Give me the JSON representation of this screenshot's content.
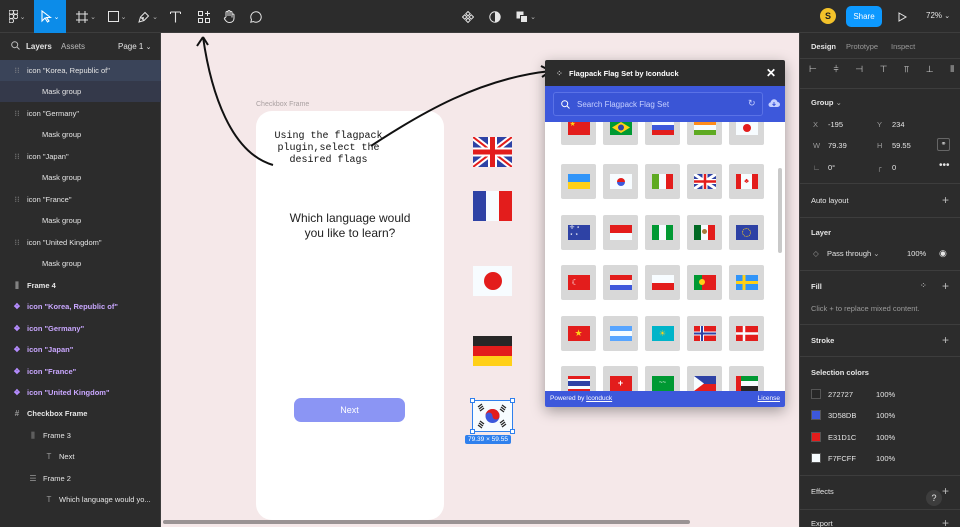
{
  "toolbar": {
    "share_label": "Share",
    "zoom": "72%",
    "avatar_initial": "S"
  },
  "layers": {
    "tab_layers": "Layers",
    "tab_assets": "Assets",
    "page_label": "Page 1",
    "items": [
      {
        "label": "icon \"Korea, Republic of\""
      },
      {
        "label": "Mask group"
      },
      {
        "label": "icon \"Germany\""
      },
      {
        "label": "Mask group"
      },
      {
        "label": "icon \"Japan\""
      },
      {
        "label": "Mask group"
      },
      {
        "label": "icon \"France\""
      },
      {
        "label": "Mask group"
      },
      {
        "label": "icon \"United Kingdom\""
      },
      {
        "label": "Mask group"
      },
      {
        "label": "Frame 4"
      },
      {
        "label": "icon \"Korea, Republic of\""
      },
      {
        "label": "icon \"Germany\""
      },
      {
        "label": "icon \"Japan\""
      },
      {
        "label": "icon \"France\""
      },
      {
        "label": "icon \"United Kingdom\""
      },
      {
        "label": "Checkbox Frame"
      },
      {
        "label": "Frame 3"
      },
      {
        "label": "Next"
      },
      {
        "label": "Frame 2"
      },
      {
        "label": "Which language would yo..."
      }
    ]
  },
  "canvas": {
    "frame_label": "Checkbox Frame",
    "annotation": "Using the flagpack\nplugin,select the\ndesired flags",
    "question": "Which language would\nyou like to learn?",
    "next_button": "Next",
    "selection_size": "79.39 × 59.55"
  },
  "plugin": {
    "title": "Flagpack Flag Set by Iconduck",
    "search_placeholder": "Search Flagpack Flag Set",
    "footer_prefix": "Powered by ",
    "footer_link": "Iconduck",
    "license": "License"
  },
  "design": {
    "tab_design": "Design",
    "tab_prototype": "Prototype",
    "tab_inspect": "Inspect",
    "group_label": "Group",
    "x_label": "X",
    "x_value": "-195",
    "y_label": "Y",
    "y_value": "234",
    "w_label": "W",
    "w_value": "79.39",
    "h_label": "H",
    "h_value": "59.55",
    "rotation": "0°",
    "radius": "0",
    "auto_layout": "Auto layout",
    "layer_title": "Layer",
    "blend_mode": "Pass through",
    "opacity": "100%",
    "fill_title": "Fill",
    "fill_hint": "Click + to replace mixed content.",
    "stroke_title": "Stroke",
    "selection_colors_title": "Selection colors",
    "selection_colors": [
      {
        "hex": "272727",
        "opacity": "100%",
        "color": "#272727"
      },
      {
        "hex": "3D58DB",
        "opacity": "100%",
        "color": "#3D58DB"
      },
      {
        "hex": "E31D1C",
        "opacity": "100%",
        "color": "#E31D1C"
      },
      {
        "hex": "F7FCFF",
        "opacity": "100%",
        "color": "#F7FCFF"
      }
    ],
    "effects_title": "Effects",
    "export_title": "Export",
    "help": "?"
  },
  "colors": {
    "accent": "#0d99ff",
    "plugin_blue": "#3d58db",
    "next_button": "#8b95f4",
    "selection_blue": "#2f80ed"
  },
  "icons": [
    "figma-menu-icon",
    "move-tool-icon",
    "frame-tool-icon",
    "shape-tool-icon",
    "pen-tool-icon",
    "text-tool-icon",
    "resources-icon",
    "hand-tool-icon",
    "comment-icon",
    "component-icon",
    "contrast-icon",
    "boolean-icon",
    "play-icon",
    "search-icon",
    "close-icon",
    "download-icon",
    "eye-icon"
  ]
}
